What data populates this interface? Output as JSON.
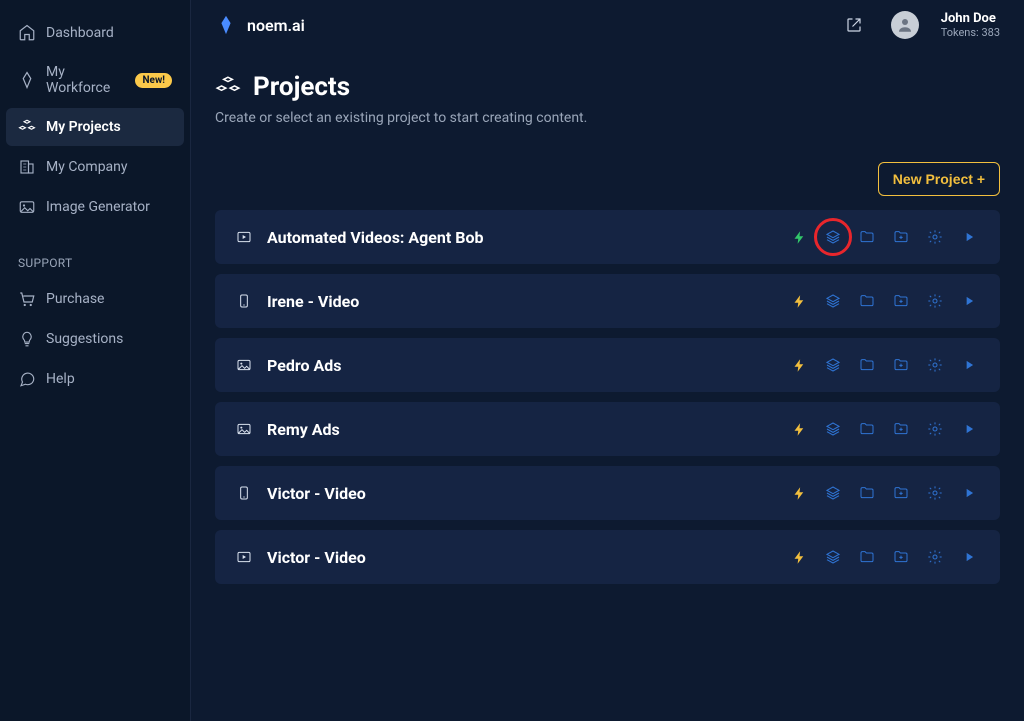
{
  "brand": {
    "name": "noem.ai"
  },
  "user": {
    "name": "John Doe",
    "tokens_label": "Tokens: 383"
  },
  "sidebar": {
    "items": [
      {
        "label": "Dashboard",
        "icon": "home"
      },
      {
        "label": "My Workforce",
        "icon": "diamond",
        "badge": "New!"
      },
      {
        "label": "My Projects",
        "icon": "cubes",
        "active": true
      },
      {
        "label": "My Company",
        "icon": "building"
      },
      {
        "label": "Image Generator",
        "icon": "image"
      }
    ],
    "support_label": "SUPPORT",
    "support_items": [
      {
        "label": "Purchase",
        "icon": "cart"
      },
      {
        "label": "Suggestions",
        "icon": "bulb"
      },
      {
        "label": "Help",
        "icon": "chat"
      }
    ]
  },
  "page": {
    "title": "Projects",
    "description": "Create or select an existing project to start creating content.",
    "new_button": "New Project +"
  },
  "projects": [
    {
      "name": "Automated Videos: Agent Bob",
      "type_icon": "video",
      "bolt_color": "green",
      "highlight_layers": true
    },
    {
      "name": "Irene - Video",
      "type_icon": "mobile",
      "bolt_color": "yellow"
    },
    {
      "name": "Pedro Ads",
      "type_icon": "image",
      "bolt_color": "yellow"
    },
    {
      "name": "Remy Ads",
      "type_icon": "image",
      "bolt_color": "yellow"
    },
    {
      "name": "Victor - Video",
      "type_icon": "mobile",
      "bolt_color": "yellow"
    },
    {
      "name": "Victor - Video",
      "type_icon": "video",
      "bolt_color": "yellow"
    }
  ]
}
